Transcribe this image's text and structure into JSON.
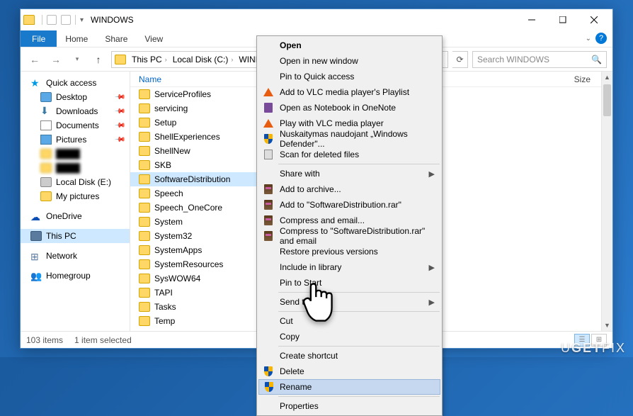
{
  "title": "WINDOWS",
  "ribbon": {
    "file": "File",
    "tabs": [
      "Home",
      "Share",
      "View"
    ]
  },
  "breadcrumb": [
    "This PC",
    "Local Disk (C:)",
    "WINDOWS"
  ],
  "search_placeholder": "Search WINDOWS",
  "columns": {
    "name": "Name",
    "size": "Size"
  },
  "nav": {
    "quick": "Quick access",
    "quick_items": [
      {
        "label": "Desktop",
        "pinned": true,
        "icon": "desktop"
      },
      {
        "label": "Downloads",
        "pinned": true,
        "icon": "download"
      },
      {
        "label": "Documents",
        "pinned": true,
        "icon": "doc"
      },
      {
        "label": "Pictures",
        "pinned": true,
        "icon": "pic"
      },
      {
        "label": "████",
        "pinned": false,
        "icon": "folder",
        "blur": true
      },
      {
        "label": "████",
        "pinned": false,
        "icon": "folder",
        "blur": true
      },
      {
        "label": "Local Disk (E:)",
        "pinned": false,
        "icon": "drive"
      },
      {
        "label": "My pictures",
        "pinned": false,
        "icon": "folder"
      }
    ],
    "onedrive": "OneDrive",
    "thispc": "This PC",
    "network": "Network",
    "homegroup": "Homegroup"
  },
  "folders": [
    "ServiceProfiles",
    "servicing",
    "Setup",
    "ShellExperiences",
    "ShellNew",
    "SKB",
    "SoftwareDistribution",
    "Speech",
    "Speech_OneCore",
    "System",
    "System32",
    "SystemApps",
    "SystemResources",
    "SysWOW64",
    "TAPI",
    "Tasks",
    "Temp"
  ],
  "selected_index": 6,
  "context_menu": [
    {
      "label": "Open",
      "bold": true
    },
    {
      "label": "Open in new window"
    },
    {
      "label": "Pin to Quick access"
    },
    {
      "label": "Add to VLC media player's Playlist",
      "icon": "vlc"
    },
    {
      "label": "Open as Notebook in OneNote",
      "icon": "note"
    },
    {
      "label": "Play with VLC media player",
      "icon": "vlc"
    },
    {
      "label": "Nuskaitymas naudojant „Windows Defender\"...",
      "icon": "shield"
    },
    {
      "label": "Scan for deleted files",
      "icon": "lib"
    },
    {
      "sep": true
    },
    {
      "label": "Share with",
      "submenu": true
    },
    {
      "label": "Add to archive...",
      "icon": "rar"
    },
    {
      "label": "Add to \"SoftwareDistribution.rar\"",
      "icon": "rar"
    },
    {
      "label": "Compress and email...",
      "icon": "rar"
    },
    {
      "label": "Compress to \"SoftwareDistribution.rar\" and email",
      "icon": "rar"
    },
    {
      "label": "Restore previous versions"
    },
    {
      "label": "Include in library",
      "submenu": true
    },
    {
      "label": "Pin to Start"
    },
    {
      "sep": true
    },
    {
      "label": "Send to",
      "submenu": true
    },
    {
      "sep": true
    },
    {
      "label": "Cut"
    },
    {
      "label": "Copy"
    },
    {
      "sep": true
    },
    {
      "label": "Create shortcut"
    },
    {
      "label": "Delete",
      "icon": "shield"
    },
    {
      "label": "Rename",
      "icon": "shield",
      "hover": true
    },
    {
      "sep": true
    },
    {
      "label": "Properties"
    }
  ],
  "status": {
    "items": "103 items",
    "selected": "1 item selected"
  },
  "watermark": {
    "u": "U",
    "get": "GET",
    "fix": "FIX"
  }
}
